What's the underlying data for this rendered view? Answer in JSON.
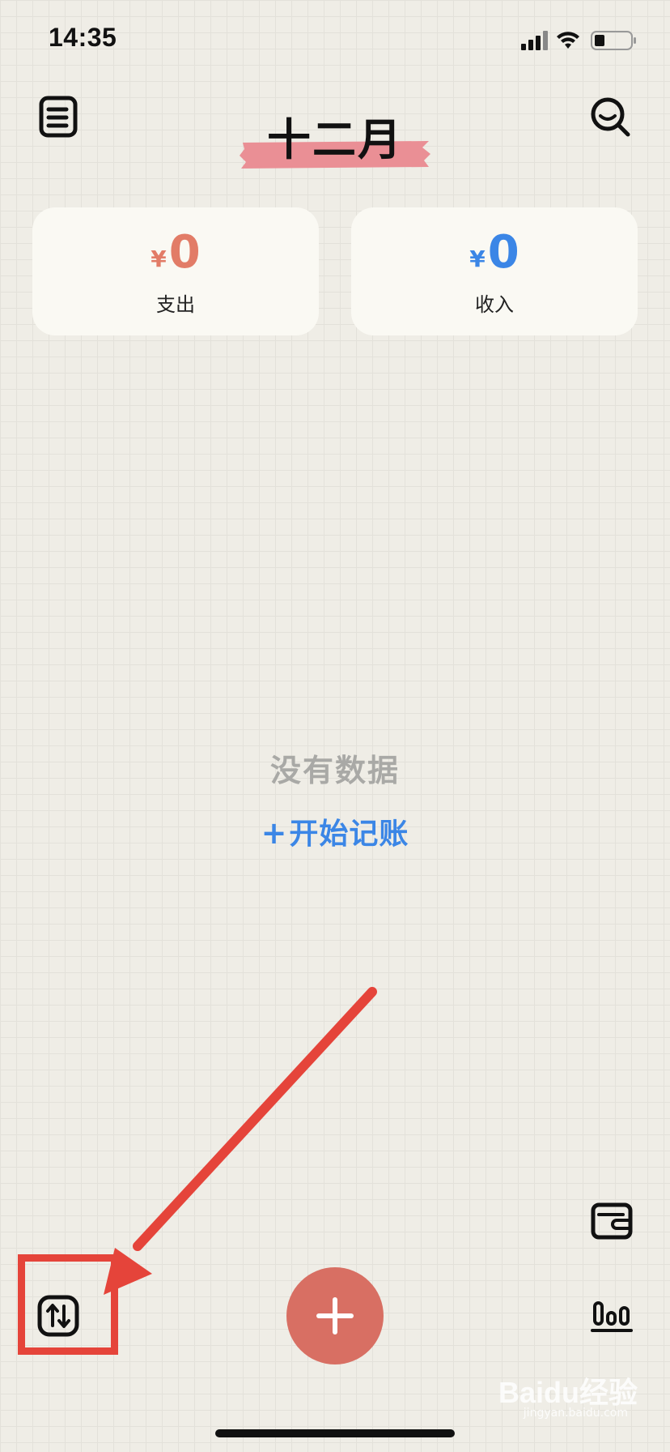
{
  "status_bar": {
    "time": "14:35"
  },
  "header": {
    "month": "十二月"
  },
  "summary": {
    "expense": {
      "currency": "¥",
      "amount": "0",
      "label": "支出"
    },
    "income": {
      "currency": "¥",
      "amount": "0",
      "label": "收入"
    }
  },
  "empty_state": {
    "message": "没有数据",
    "action_plus": "+",
    "action_label": "开始记账"
  },
  "icons": {
    "menu": "list-icon",
    "search": "search-icon",
    "wallet": "wallet-icon",
    "stats": "bar-chart-icon",
    "swap": "swap-arrows-icon",
    "add": "plus-icon"
  },
  "watermark": {
    "brand": "Baidu经验",
    "url": "jingyan.baidu.com"
  },
  "colors": {
    "expense": "#e27c67",
    "income": "#3b86e6",
    "fab": "#d86f63",
    "tape": "#ea8f95",
    "annotation": "#e5443a"
  }
}
